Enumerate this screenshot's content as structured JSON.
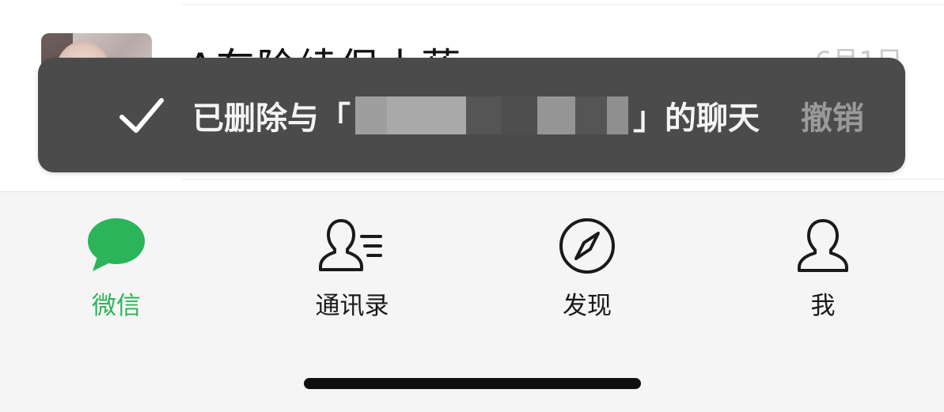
{
  "chat_row": {
    "name": "A车险续保小蒋",
    "date": "6月1日"
  },
  "toast": {
    "message_prefix": "已删除与「",
    "message_suffix": "」的聊天",
    "undo_label": "撤销"
  },
  "tabbar": {
    "accent_color": "#2bb45a",
    "tabs": [
      {
        "label": "微信",
        "icon": "chat-bubble-icon",
        "active": true
      },
      {
        "label": "通讯录",
        "icon": "contacts-icon",
        "active": false
      },
      {
        "label": "发现",
        "icon": "compass-icon",
        "active": false
      },
      {
        "label": "我",
        "icon": "person-icon",
        "active": false
      }
    ]
  }
}
